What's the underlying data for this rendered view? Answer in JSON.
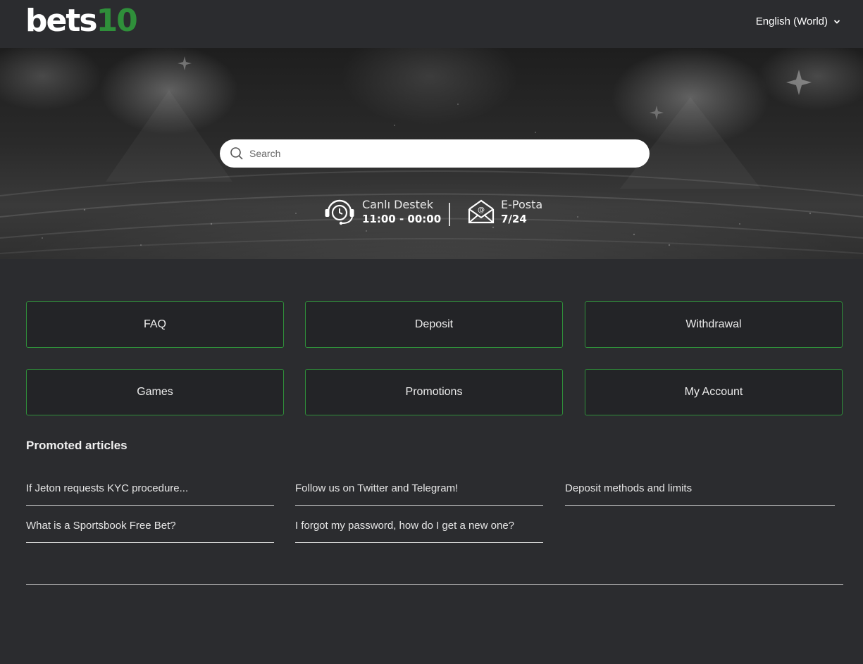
{
  "header": {
    "logo_text_main": "bets",
    "logo_text_accent": "10",
    "language": "English (World)"
  },
  "hero": {
    "search": {
      "placeholder": "Search",
      "value": ""
    },
    "contacts": [
      {
        "title": "Canlı Destek",
        "value": "11:00 - 00:00",
        "icon": "headset-clock-icon"
      },
      {
        "title": "E-Posta",
        "value": "7/24",
        "icon": "email-icon"
      }
    ]
  },
  "categories": [
    {
      "label": "FAQ"
    },
    {
      "label": "Deposit"
    },
    {
      "label": "Withdrawal"
    },
    {
      "label": "Games"
    },
    {
      "label": "Promotions"
    },
    {
      "label": "My Account"
    }
  ],
  "promoted": {
    "title": "Promoted articles",
    "articles": [
      {
        "label": "If Jeton requests KYC procedure..."
      },
      {
        "label": "Follow us on Twitter and Telegram!"
      },
      {
        "label": "Deposit methods and limits"
      },
      {
        "label": "What is a Sportsbook Free Bet?"
      },
      {
        "label": "I forgot my password, how do I get a new one?"
      }
    ]
  },
  "colors": {
    "background": "#2b2c2f",
    "accent": "#2f8f3a",
    "card_border": "#2f8f3a"
  }
}
